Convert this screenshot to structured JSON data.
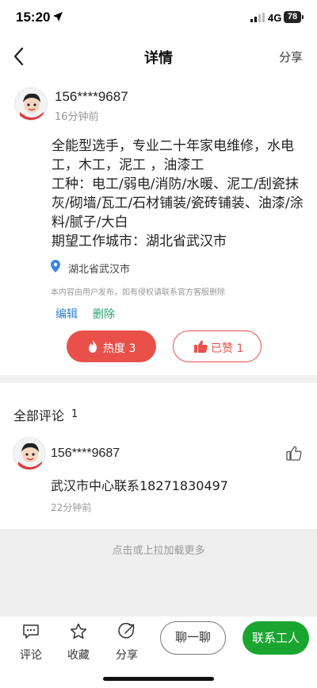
{
  "status_bar": {
    "time": "15:20",
    "network": "4G",
    "battery": "78"
  },
  "nav": {
    "title": "详情",
    "share": "分享"
  },
  "post": {
    "user": "156****9687",
    "time": "16分钟前",
    "lines": [
      "全能型选手，专业二十年家电维修，水电工，木工，泥工 ，油漆工",
      "工种：电工/弱电/消防/水暖、泥工/刮瓷抹灰/砌墙/瓦工/石材铺装/瓷砖铺装、油漆/涂料/腻子/大白",
      "期望工作城市：湖北省武汉市"
    ],
    "location": "湖北省武汉市",
    "disclaimer": "本内容由用户发布，如有侵权请联系官方客服删除",
    "edit": "编辑",
    "delete": "删除",
    "hot_label": "热度 3",
    "like_label": "已赞 1"
  },
  "comments": {
    "heading": "全部评论",
    "count": "1",
    "items": [
      {
        "user": "156****9687",
        "text": "武汉市中心联系18271830497",
        "time": "22分钟前"
      }
    ],
    "load_more": "点击或上拉加载更多"
  },
  "toolbar": {
    "comment": "评论",
    "favorite": "收藏",
    "share": "分享",
    "chat": "聊一聊",
    "contact": "联系工人"
  },
  "colors": {
    "accent_red": "#e9504a",
    "green": "#19a52f",
    "link_blue": "#2d7fd8"
  },
  "icons": [
    "back-chevron-icon",
    "location-pin-icon",
    "flame-icon",
    "thumbs-up-icon",
    "comment-icon",
    "star-icon",
    "share-icon"
  ]
}
